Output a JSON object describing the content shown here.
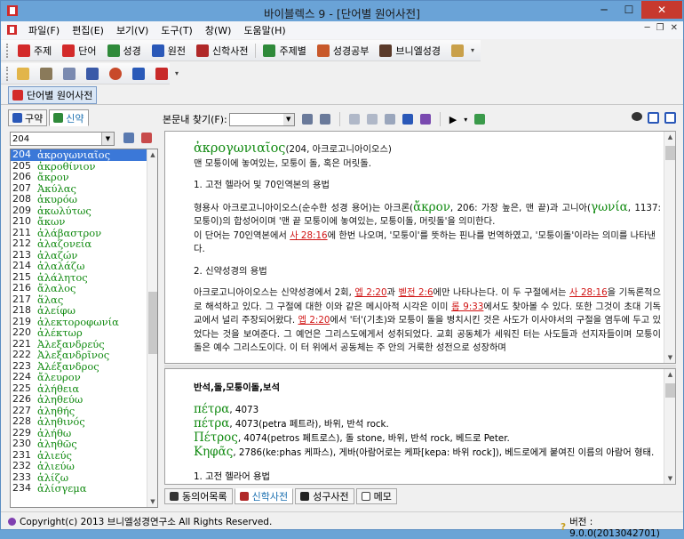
{
  "window": {
    "title": "바이블렉스 9 - [단어별 원어사전]",
    "minimize": "─",
    "maximize": "☐",
    "close": "✕"
  },
  "menu": [
    "파일(F)",
    "편집(E)",
    "보기(V)",
    "도구(T)",
    "창(W)",
    "도움말(H)"
  ],
  "toolbar1": [
    {
      "label": "주제",
      "icon": "red-book-icon",
      "color": "#d32a2a"
    },
    {
      "label": "단어",
      "icon": "red-book-icon",
      "color": "#d32a2a"
    },
    {
      "label": "성경",
      "icon": "green-books-icon",
      "color": "#2f8a3a"
    },
    {
      "label": "원전",
      "icon": "blue-books-icon",
      "color": "#2a58b8"
    },
    {
      "label": "신학사전",
      "icon": "red-books-icon",
      "color": "#b02828"
    },
    {
      "label": "주제별",
      "icon": "green-book-icon",
      "color": "#2f8a3a"
    },
    {
      "label": "성경공부",
      "icon": "orange-books-icon",
      "color": "#c8582a"
    },
    {
      "label": "브니엘성경",
      "icon": "dark-book-icon",
      "color": "#5a3a2a"
    }
  ],
  "toolbar2_icons": [
    "folder-icon",
    "edit-icon",
    "document-icon",
    "save-icon",
    "globe-icon",
    "word-icon",
    "pdf-icon"
  ],
  "doc_tab": "단어별 원어사전",
  "left_tabs": [
    {
      "label": "구약",
      "active": false
    },
    {
      "label": "신약",
      "active": true
    }
  ],
  "left_search": {
    "value": "204"
  },
  "word_list": [
    {
      "num": "204",
      "greek": "ἀκρογωνιαῖος",
      "selected": true
    },
    {
      "num": "205",
      "greek": "ἀκροθίνιον"
    },
    {
      "num": "206",
      "greek": "ἄκρον"
    },
    {
      "num": "207",
      "greek": "Ἀκύλας"
    },
    {
      "num": "208",
      "greek": "ἀκυρόω"
    },
    {
      "num": "209",
      "greek": "ἀκωλύτως"
    },
    {
      "num": "210",
      "greek": "ἄκων"
    },
    {
      "num": "211",
      "greek": "ἀλάβαστρον"
    },
    {
      "num": "212",
      "greek": "ἀλαζονεία"
    },
    {
      "num": "213",
      "greek": "ἀλαζών"
    },
    {
      "num": "214",
      "greek": "ἀλαλάζω"
    },
    {
      "num": "215",
      "greek": "ἀλάλητος"
    },
    {
      "num": "216",
      "greek": "ἄλαλος"
    },
    {
      "num": "217",
      "greek": "ἅλας"
    },
    {
      "num": "218",
      "greek": "ἀλείφω"
    },
    {
      "num": "219",
      "greek": "ἀλεκτοροφωνία"
    },
    {
      "num": "220",
      "greek": "ἀλέκτωρ"
    },
    {
      "num": "221",
      "greek": "Ἀλεξανδρεύς"
    },
    {
      "num": "222",
      "greek": "Ἀλεξανδρῖνος"
    },
    {
      "num": "223",
      "greek": "Ἀλέξανδρος"
    },
    {
      "num": "224",
      "greek": "ἄλευρον"
    },
    {
      "num": "225",
      "greek": "ἀλήθεια"
    },
    {
      "num": "226",
      "greek": "ἀληθεύω"
    },
    {
      "num": "227",
      "greek": "ἀληθής"
    },
    {
      "num": "228",
      "greek": "ἀληθινός"
    },
    {
      "num": "229",
      "greek": "ἀλήθω"
    },
    {
      "num": "230",
      "greek": "ἀληθῶς"
    },
    {
      "num": "231",
      "greek": "ἁλιεύς"
    },
    {
      "num": "232",
      "greek": "ἁλιεύω"
    },
    {
      "num": "233",
      "greek": "ἁλίζω"
    },
    {
      "num": "234",
      "greek": "ἀλίσγεμα"
    }
  ],
  "right_toolbar": {
    "find_label": "본문내 찾기(F):"
  },
  "entry": {
    "headword": "ἀκρογωνιαῖος",
    "head_info": "(204, 아크로고니아이오스)",
    "definition": "맨 모퉁이에 놓여있는, 모퉁이 돌, 혹은 머릿돌.",
    "section1_title": "1. 고전 헬라어 및 70인역본의 용법",
    "s1_p1_a": "형용사 아크로고니아이오스(순수한 성경 용어)는 아크론(",
    "s1_p1_greek1": "ἄκρον",
    "s1_p1_b": ", 206: 가장 높은, 맨 끝)과 고니아(",
    "s1_p1_greek2": "γωνία",
    "s1_p1_c": ", 1137: 모퉁이)의 합성어이며 '맨 끝 모퉁이에 놓여있는, 모퉁이돌, 머릿돌'을 의미한다.",
    "s1_p2_a": "이 단어는 70인역본에서 ",
    "s1_p2_ref": "사 28:16",
    "s1_p2_b": "에 한번 나오며, '모퉁이'를 뜻하는 핀나를 번역하였고, '모퉁이돌'이라는 의미를 나타낸다.",
    "section2_title": "2. 신약성경의 용법",
    "s2_p1_a": "아크로고니아이오스는 신약성경에서 2회, ",
    "s2_ref1": "엡 2:20",
    "s2_p1_b": "과 ",
    "s2_ref2": "벧전 2:6",
    "s2_p1_c": "에만 나타나는다. 이 두 구절에서는 ",
    "s2_ref3": "사 28:16",
    "s2_p1_d": "을 기독론적으로 해석하고 있다. 그 구절에 대한 이와 같은 메시아적 시각은 이미 ",
    "s2_ref4": "롬 9:33",
    "s2_p1_e": "에서도 찾아볼 수 있다. 또한 그것이 초대 기독교에서 널리 주장되어왔다. ",
    "s2_ref5": "엡 2:20",
    "s2_p1_f": "에서 '터'(기초)와 모퉁이 돌을 병치시킨 것은 사도가 이사야서의 구절을 염두에 두고 있었다는 것을 보여준다. 그 예언은 그리스도에게서 성취되었다. 교회 공동체가 세워진 터는 사도들과 선지자들이며 모퉁이 돌은 예수 그리스도이다. 이 터 위에서 공동체는 주 안의 거룩한 성전으로 성장하며"
  },
  "related": {
    "title": "반석,돌,모퉁이돌,보석",
    "items": [
      {
        "greek": "πέτρα",
        "text": ", 4073"
      },
      {
        "greek": "πέτρα",
        "text": ", 4073(petra 페트라), 바위, 반석 rock."
      },
      {
        "greek": "Πέτρος",
        "text": ", 4074(petros 페트로스), 돌 stone, 바위, 반석 rock, 베드로 Peter."
      },
      {
        "greek": "Κηφᾶς",
        "text": ", 2786(ke:phas 케파스), 게바(아람어로는 케파[kepa: 바위 rock]), 베드로에게 붙여진 이름의 아람어 형태."
      }
    ],
    "tail": "1. 고전 헬라어 용법"
  },
  "bottom_tabs": [
    {
      "label": "동의어목록",
      "active": false
    },
    {
      "label": "신학사전",
      "active": true
    },
    {
      "label": "성구사전",
      "active": false
    },
    {
      "label": "메모",
      "active": false
    }
  ],
  "status": {
    "copyright": "Copyright(c) 2013 브니엘성경연구소 All Rights Reserved.",
    "version": "버전 : 9.0.0(2013042701)"
  }
}
